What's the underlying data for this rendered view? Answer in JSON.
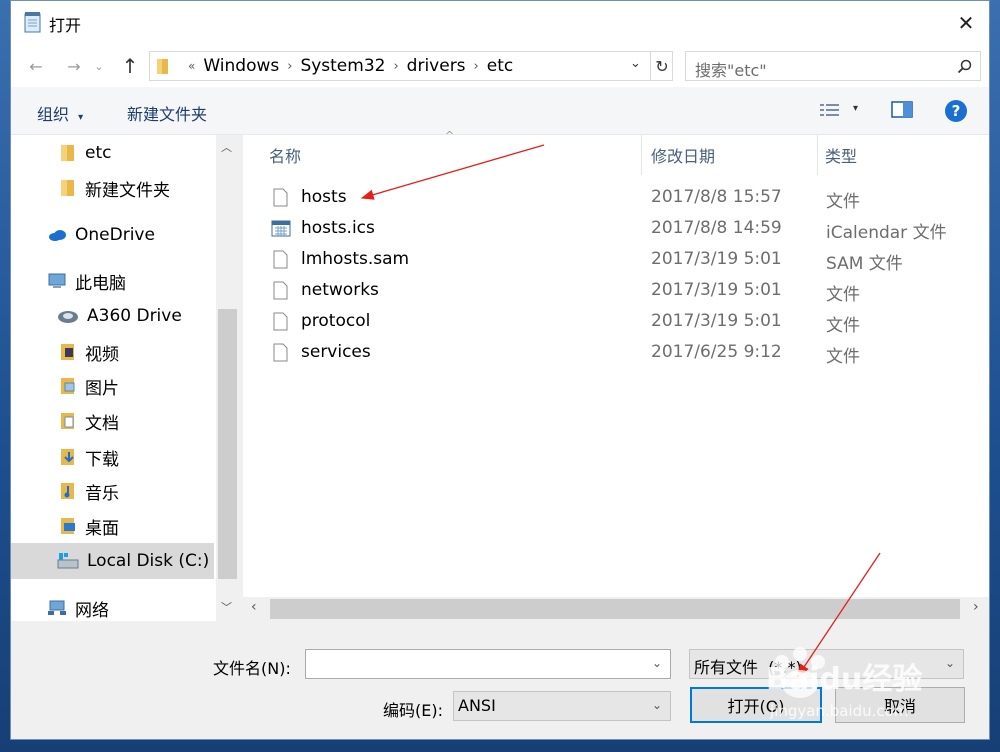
{
  "dialog": {
    "title": "打开",
    "close_glyph": "✕"
  },
  "address": {
    "overflow": "«",
    "crumbs": [
      "Windows",
      "System32",
      "drivers",
      "etc"
    ]
  },
  "search": {
    "placeholder": "搜索\"etc\""
  },
  "toolbar": {
    "organize": "组织",
    "new_folder": "新建文件夹"
  },
  "nav": {
    "items": [
      {
        "label": "etc",
        "icon": "folder-icon"
      },
      {
        "label": "新建文件夹",
        "icon": "folder-icon"
      },
      {
        "label": "OneDrive",
        "icon": "cloud-icon"
      },
      {
        "label": "此电脑",
        "icon": "computer-icon"
      },
      {
        "label": "A360 Drive",
        "icon": "a360-drive-icon"
      },
      {
        "label": "视频",
        "icon": "videos-folder-icon"
      },
      {
        "label": "图片",
        "icon": "pictures-folder-icon"
      },
      {
        "label": "文档",
        "icon": "documents-folder-icon"
      },
      {
        "label": "下载",
        "icon": "downloads-folder-icon"
      },
      {
        "label": "音乐",
        "icon": "music-folder-icon"
      },
      {
        "label": "桌面",
        "icon": "desktop-folder-icon"
      },
      {
        "label": "Local Disk (C:)",
        "icon": "local-disk-icon"
      },
      {
        "label": "网络",
        "icon": "network-icon"
      }
    ]
  },
  "columns": {
    "name": "名称",
    "modified": "修改日期",
    "type": "类型"
  },
  "files": [
    {
      "name": "hosts",
      "modified": "2017/8/8 15:57",
      "type": "文件",
      "icon": "file-icon"
    },
    {
      "name": "hosts.ics",
      "modified": "2017/8/8 14:59",
      "type": "iCalendar 文件",
      "icon": "calendar-file-icon"
    },
    {
      "name": "lmhosts.sam",
      "modified": "2017/3/19 5:01",
      "type": "SAM 文件",
      "icon": "file-icon"
    },
    {
      "name": "networks",
      "modified": "2017/3/19 5:01",
      "type": "文件",
      "icon": "file-icon"
    },
    {
      "name": "protocol",
      "modified": "2017/3/19 5:01",
      "type": "文件",
      "icon": "file-icon"
    },
    {
      "name": "services",
      "modified": "2017/6/25 9:12",
      "type": "文件",
      "icon": "file-icon"
    }
  ],
  "bottom": {
    "filename_label": "文件名(N):",
    "filename_value": "",
    "filetype_value": "所有文件  (*.*)",
    "encoding_label": "编码(E):",
    "encoding_value": "ANSI",
    "open_button": "打开(O)",
    "cancel_button": "取消"
  },
  "watermark": {
    "logo": "Baidu经验",
    "url": "jingyan.baidu.com"
  },
  "colors": {
    "accent": "#0078d7",
    "annotation_arrow": "#e3201b",
    "selection": "#d9d9d9"
  }
}
